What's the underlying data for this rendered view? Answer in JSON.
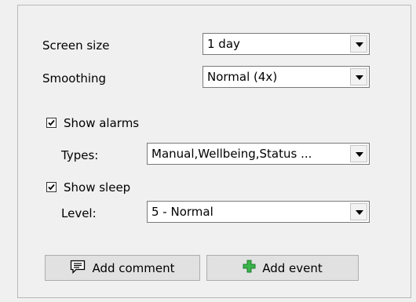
{
  "screen_size": {
    "label": "Screen size",
    "value": "1 day"
  },
  "smoothing": {
    "label": "Smoothing",
    "value": "Normal (4x)"
  },
  "alarms": {
    "checkbox_label": "Show alarms",
    "checked": true,
    "types_label": "Types:",
    "types_value": "Manual,Wellbeing,Status ..."
  },
  "sleep": {
    "checkbox_label": "Show sleep",
    "checked": true,
    "level_label": "Level:",
    "level_value": "5 - Normal"
  },
  "buttons": {
    "add_comment": "Add comment",
    "add_event": "Add event"
  },
  "colors": {
    "add_event_icon": "#39b54a",
    "panel_border": "#b9b9b9"
  }
}
